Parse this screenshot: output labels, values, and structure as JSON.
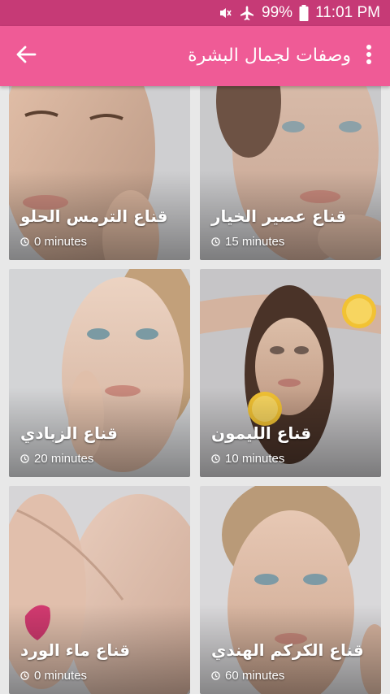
{
  "status_bar": {
    "battery": "99%",
    "time": "11:01 PM",
    "icons": [
      "mute-icon",
      "airplane-icon",
      "battery-icon"
    ]
  },
  "app_bar": {
    "title": "وصفات لجمال البشرة",
    "back_icon": "arrow-left-icon",
    "menu_icon": "more-vert-icon"
  },
  "colors": {
    "status_bar": "#c63a76",
    "app_bar": "#ef5b96",
    "background": "#e8e8e8"
  },
  "recipes": [
    {
      "title": "قناع الترمس الحلو",
      "time": "0 minutes"
    },
    {
      "title": "قناع عصير الخيار",
      "time": "15 minutes"
    },
    {
      "title": "قناع الزبادي",
      "time": "20 minutes"
    },
    {
      "title": "قناع الليمون",
      "time": "10 minutes"
    },
    {
      "title": "قناع ماء الورد",
      "time": "0 minutes"
    },
    {
      "title": "قناع الكركم الهندي",
      "time": "60 minutes"
    }
  ]
}
